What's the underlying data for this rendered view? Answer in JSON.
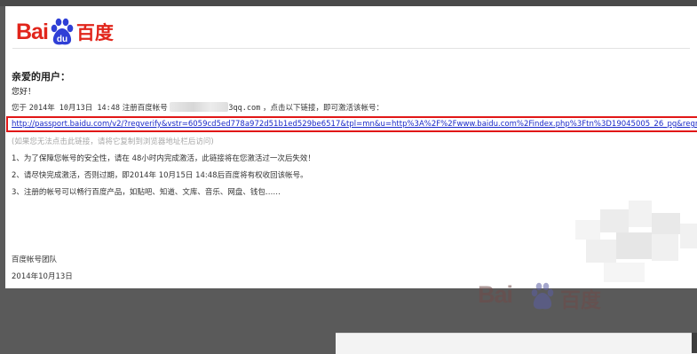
{
  "logo": {
    "text_en": "Bai",
    "text_cn": "百度",
    "paw_icon": "baidu-paw-icon",
    "brand_color": "#e1251b"
  },
  "email": {
    "greeting": "亲爱的用户：",
    "hello": "您好！",
    "line1_prefix": "您于",
    "line1_date": "2014年 10月13日 14:48",
    "line1_register": "注册百度帐号",
    "line1_account_suffix": "3qq.com",
    "line1_suffix": "，点击以下链接，即可激活该帐号：",
    "activation_link": "http://passport.baidu.com/v2/?regverify&vstr=6059cd5ed778a972d51b1ed529be6517&tpl=mn&u=http%3A%2F%2Fwww.baidu.com%2Findex.php%3Ftn%3D19045005_26_pg&regmerge=",
    "hint": "(如果您无法点击此链接，请将它复制到浏览器地址栏后访问)",
    "items": [
      "1、为了保障您帐号的安全性，请在 48小时内完成激活，此链接将在您激活过一次后失效！",
      "2、请尽快完成激活，否则过期，即2014年 10月15日 14:48后百度将有权收回该帐号。",
      "3、注册的帐号可以畅行百度产品，如贴吧、知道、文库、音乐、网盘、钱包……"
    ],
    "signature": "百度帐号团队",
    "signature_date": "2014年10月13日"
  },
  "background": {
    "watermark_en": "Bai",
    "watermark_cn": "百度"
  },
  "colors": {
    "link": "#1a29c9",
    "highlight_box": "#e11717",
    "hint": "#a7a7a7"
  }
}
